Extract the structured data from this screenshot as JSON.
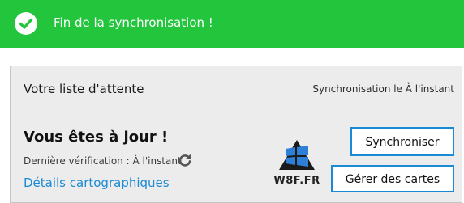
{
  "banner": {
    "message": "Fin de la synchronisation !",
    "icon": "check-circle-icon",
    "color": "#22c53c"
  },
  "queue": {
    "title": "Votre liste d'attente",
    "sync_status": "Synchronisation le À l'instant"
  },
  "status": {
    "headline": "Vous êtes à jour !",
    "last_check": "Dernière vérification : À l'instant",
    "refresh_icon": "refresh-icon",
    "details_link": "Détails cartographiques"
  },
  "buttons": {
    "sync_label": "Synchroniser",
    "manage_label": "Gérer des cartes",
    "accent": "#1a8ad4"
  },
  "watermark": {
    "text": "W8F.FR"
  }
}
